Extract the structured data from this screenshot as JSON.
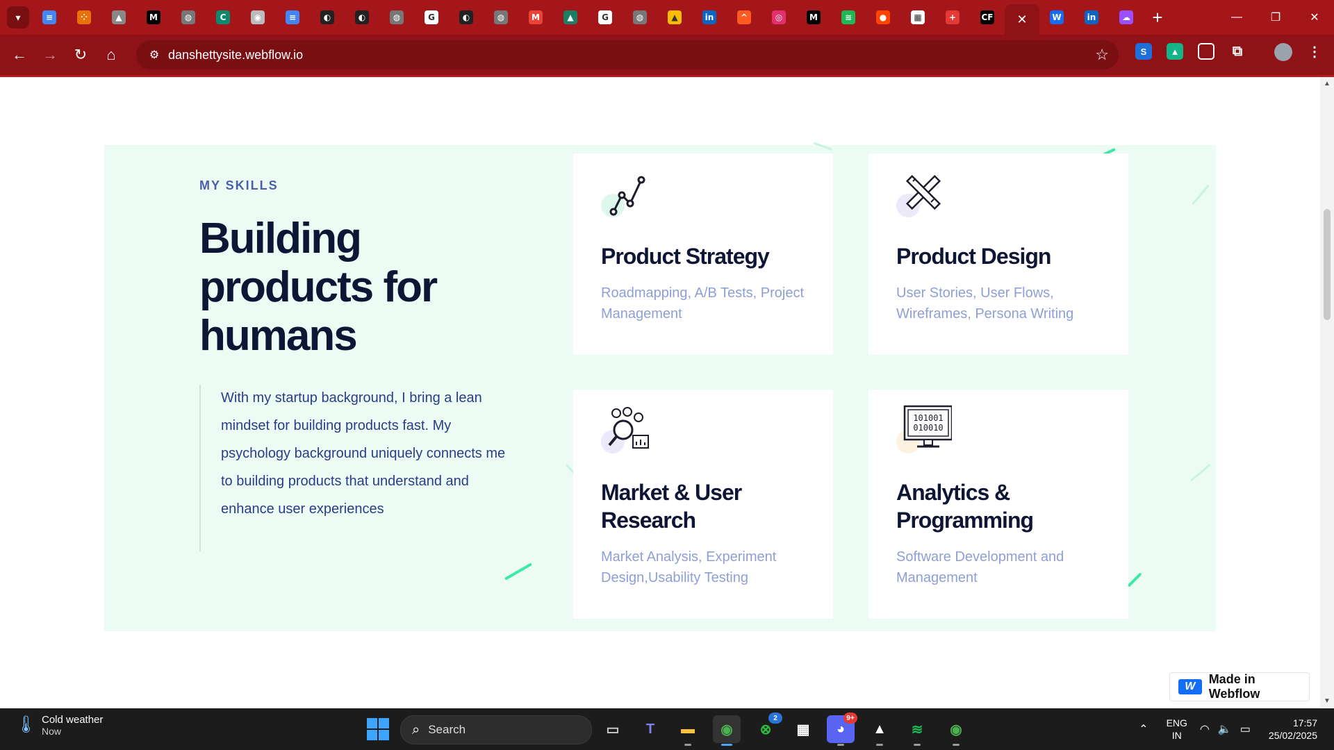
{
  "browser": {
    "tab_favicons": [
      {
        "icon": "docs-icon",
        "color": "#4285f4",
        "glyph": "≡"
      },
      {
        "icon": "app-grid-icon",
        "color": "#e8710a",
        "glyph": "⁘"
      },
      {
        "icon": "android-icon",
        "color": "#888888",
        "glyph": "▲"
      },
      {
        "icon": "medium-icon",
        "color": "#000000",
        "glyph": "M"
      },
      {
        "icon": "globe-icon",
        "color": "#777777",
        "glyph": "◍"
      },
      {
        "icon": "cf-icon",
        "color": "#0b8a6e",
        "glyph": "C"
      },
      {
        "icon": "chrome-icon",
        "color": "#bbbbbb",
        "glyph": "◉"
      },
      {
        "icon": "docs-icon",
        "color": "#4285f4",
        "glyph": "≡"
      },
      {
        "icon": "github-icon",
        "color": "#222222",
        "glyph": "◐"
      },
      {
        "icon": "github-icon",
        "color": "#222222",
        "glyph": "◐"
      },
      {
        "icon": "globe-icon",
        "color": "#777777",
        "glyph": "◍"
      },
      {
        "icon": "google-icon",
        "color": "#ffffff",
        "glyph": "G"
      },
      {
        "icon": "github-icon",
        "color": "#222222",
        "glyph": "◐"
      },
      {
        "icon": "globe-icon",
        "color": "#777777",
        "glyph": "◍"
      },
      {
        "icon": "gmail-icon",
        "color": "#ea4335",
        "glyph": "M"
      },
      {
        "icon": "mountain-icon",
        "color": "#1a7f64",
        "glyph": "▲"
      },
      {
        "icon": "google-icon",
        "color": "#ffffff",
        "glyph": "G"
      },
      {
        "icon": "globe-icon",
        "color": "#777777",
        "glyph": "◍"
      },
      {
        "icon": "drive-icon",
        "color": "#fbbc04",
        "glyph": "▲"
      },
      {
        "icon": "linkedin-icon",
        "color": "#0a66c2",
        "glyph": "in"
      },
      {
        "icon": "arrow-icon",
        "color": "#ff5a1f",
        "glyph": "^"
      },
      {
        "icon": "instagram-icon",
        "color": "#e1306c",
        "glyph": "◎"
      },
      {
        "icon": "medium-icon",
        "color": "#000000",
        "glyph": "M"
      },
      {
        "icon": "spotify-icon",
        "color": "#1db954",
        "glyph": "≋"
      },
      {
        "icon": "reddit-icon",
        "color": "#ff4500",
        "glyph": "●"
      },
      {
        "icon": "sheets-icon",
        "color": "#ffffff",
        "glyph": "▦"
      },
      {
        "icon": "plus-circle-icon",
        "color": "#e53935",
        "glyph": "+"
      },
      {
        "icon": "codeforces-icon",
        "color": "#000000",
        "glyph": "CF"
      }
    ],
    "active_tab_close": "✕",
    "tabs_after": [
      {
        "icon": "webflow-icon",
        "color": "#146ef5",
        "glyph": "W"
      },
      {
        "icon": "linkedin-icon",
        "color": "#0a66c2",
        "glyph": "in"
      },
      {
        "icon": "cloud-icon",
        "color": "#9b4dff",
        "glyph": "☁"
      }
    ],
    "new_tab": "+",
    "url": "danshettysite.webflow.io"
  },
  "page": {
    "eyebrow": "MY SKILLS",
    "headline": "Building products for humans",
    "intro": "With my startup background, I bring a lean mindset for building products fast. My psychology background uniquely connects me to building products that understand and enhance user experiences",
    "cards": [
      {
        "icon": "line-chart-icon",
        "title": "Product Strategy",
        "desc": "Roadmapping,  A/B Tests, Project Management",
        "blob": "#dff8ee"
      },
      {
        "icon": "pencil-ruler-icon",
        "title": "Product Design",
        "desc": "User Stories, User Flows, Wireframes, Persona Writing",
        "blob": "#ece9fb"
      },
      {
        "icon": "research-icon",
        "title": "Market & User Research",
        "desc": "Market Analysis, Experiment Design,Usability Testing",
        "blob": "#ece9fb"
      },
      {
        "icon": "binary-monitor-icon",
        "title": "Analytics & Programming",
        "desc": "Software Development and Management",
        "blob": "#fdf1e0"
      }
    ],
    "badge": "Made in Webflow"
  },
  "taskbar": {
    "weather_title": "Cold weather",
    "weather_sub": "Now",
    "search_label": "Search",
    "xbox_badge": "2",
    "discord_badge": "9+",
    "lang_1": "ENG",
    "lang_2": "IN",
    "time": "17:57",
    "date": "25/02/2025"
  }
}
